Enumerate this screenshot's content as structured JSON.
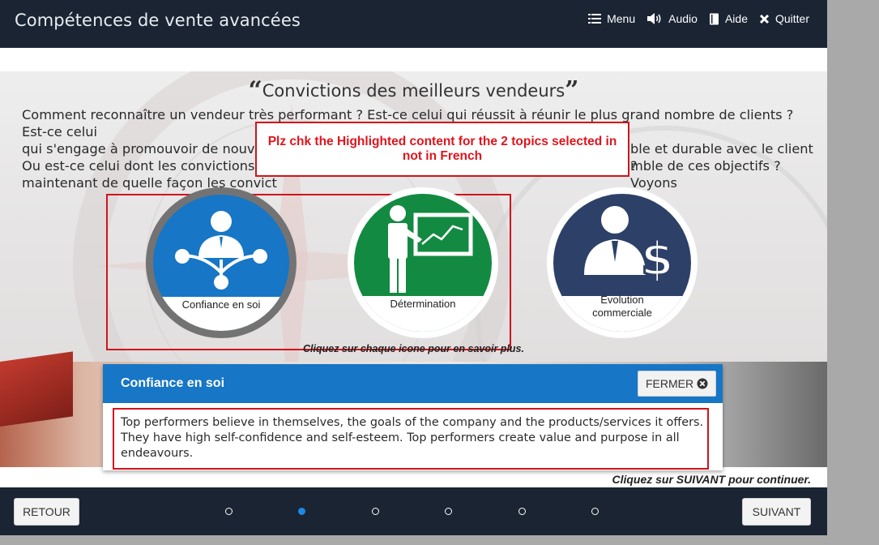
{
  "header": {
    "course_title": "Compétences de vente avancées",
    "nav": [
      {
        "label": "Menu",
        "icon": "list-icon"
      },
      {
        "label": "Audio",
        "icon": "speaker-icon"
      },
      {
        "label": "Aide",
        "icon": "book-icon"
      },
      {
        "label": "Quitter",
        "icon": "close-icon"
      }
    ]
  },
  "slide": {
    "title": "Convictions des meilleurs vendeurs",
    "quote_open": "“",
    "quote_close": "”",
    "intro_lines": [
      "Comment reconnaître un vendeur très performant ? Est-ce celui qui réussit à réunir le plus grand nombre de clients ? Est-ce celui",
      "qui s'engage à promouvoir de nouveau",
      "ble et durable avec le client ?",
      "Ou est-ce celui dont les convictions, co",
      "mble de ces objectifs ? Voyons",
      "maintenant de quelle façon les convict"
    ],
    "annotation": "Plz chk the Highlighted content for the 2 topics selected in not in French",
    "topics": [
      {
        "label": "Confiance en soi",
        "icon": "network-person-icon",
        "color": "#1776c6"
      },
      {
        "label": "Détermination",
        "icon": "presenter-chart-icon",
        "color": "#138a41"
      },
      {
        "label": "Evolution commerciale",
        "icon": "businessman-dollar-icon",
        "color": "#2c4068"
      }
    ],
    "hint": "Cliquez sur chaque icone pour en savoir plus."
  },
  "panel": {
    "title": "Confiance en soi",
    "close_label": "FERMER",
    "body": "Top performers believe in themselves, the goals of the company and the products/services it offers. They have high self-confidence and self-esteem. Top performers create value and purpose in all endeavours."
  },
  "footer": {
    "continue_hint": "Cliquez sur SUIVANT pour continuer.",
    "back_label": "RETOUR",
    "next_label": "SUIVANT",
    "pages": 6,
    "current_page": 2
  },
  "colors": {
    "bar": "#1a2433",
    "accent_blue": "#1776c6",
    "annotation_red": "#d0141c"
  }
}
